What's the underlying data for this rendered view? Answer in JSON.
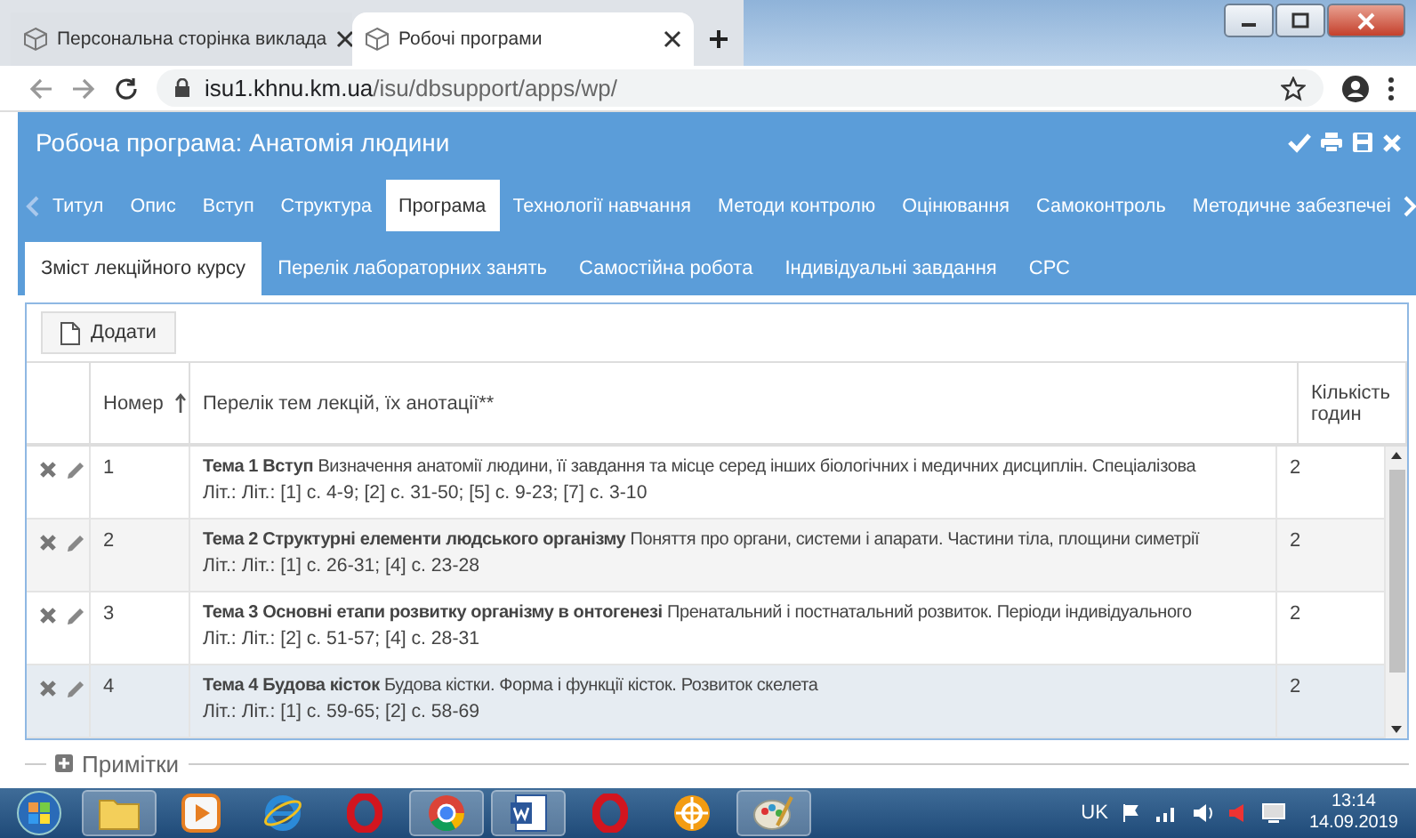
{
  "browser": {
    "tabs": [
      {
        "title": "Персональна сторінка виклада",
        "selected": false
      },
      {
        "title": "Робочі програми",
        "selected": true
      }
    ],
    "url_host": "isu1.khnu.km.ua",
    "url_path": "/isu/dbsupport/apps/wp/"
  },
  "app": {
    "title": "Робоча програма: Анатомія людини",
    "tabs": [
      {
        "label": "Титул",
        "selected": false
      },
      {
        "label": "Опис",
        "selected": false
      },
      {
        "label": "Вступ",
        "selected": false
      },
      {
        "label": "Структура",
        "selected": false
      },
      {
        "label": "Програма",
        "selected": true
      },
      {
        "label": "Технології навчання",
        "selected": false
      },
      {
        "label": "Методи контролю",
        "selected": false
      },
      {
        "label": "Оцінювання",
        "selected": false
      },
      {
        "label": "Самоконтроль",
        "selected": false
      },
      {
        "label": "Методичне забезпечеі",
        "selected": false
      }
    ],
    "subtabs": [
      {
        "label": "Зміст лекційного курсу",
        "selected": true
      },
      {
        "label": "Перелік лабораторних занять",
        "selected": false
      },
      {
        "label": "Самостійна робота",
        "selected": false
      },
      {
        "label": "Індивідуальні завдання",
        "selected": false
      },
      {
        "label": "СРС",
        "selected": false
      }
    ],
    "add_button": "Додати",
    "table": {
      "columns": [
        "Номер",
        "Перелік тем лекцій, їх анотації**",
        "Кількість годин"
      ],
      "rows": [
        {
          "number": "1",
          "topic": "**Тема 1 Вступ** Визначення анатомії людини, її завдання та місце серед інших біологічних і медичних дисциплін. Спеціалізова",
          "literature": "Літ.: Літ.: [1] с. 4-9; [2] с. 31-50; [5] с. 9-23; [7] с. 3-10",
          "hours": "2",
          "selected": false
        },
        {
          "number": "2",
          "topic": "**Тема 2 Структурні елементи людського організму** Поняття про органи, системи і апарати. Частини тіла, площини симетрії",
          "literature": "Літ.: Літ.: [1] с. 26-31; [4] с. 23-28",
          "hours": "2",
          "selected": false
        },
        {
          "number": "3",
          "topic": "**Тема 3 Основні етапи розвитку організму в онтогенезі** Пренатальний і постнатальний розвиток. Періоди індивідуального",
          "literature": "Літ.: Літ.: [2] с. 51-57; [4] с. 28-31",
          "hours": "2",
          "selected": false
        },
        {
          "number": "4",
          "topic": "**Тема 4 Будова кісток** Будова кістки. Форма і функції кісток. Розвиток скелета",
          "literature": "Літ.: Літ.: [1] с. 59-65; [2] с. 58-69",
          "hours": "2",
          "selected": true
        }
      ]
    },
    "notes": {
      "label": "Примітки",
      "expanded": false
    }
  },
  "taskbar": {
    "language": "UK",
    "time": "13:14",
    "date": "14.09.2019"
  }
}
